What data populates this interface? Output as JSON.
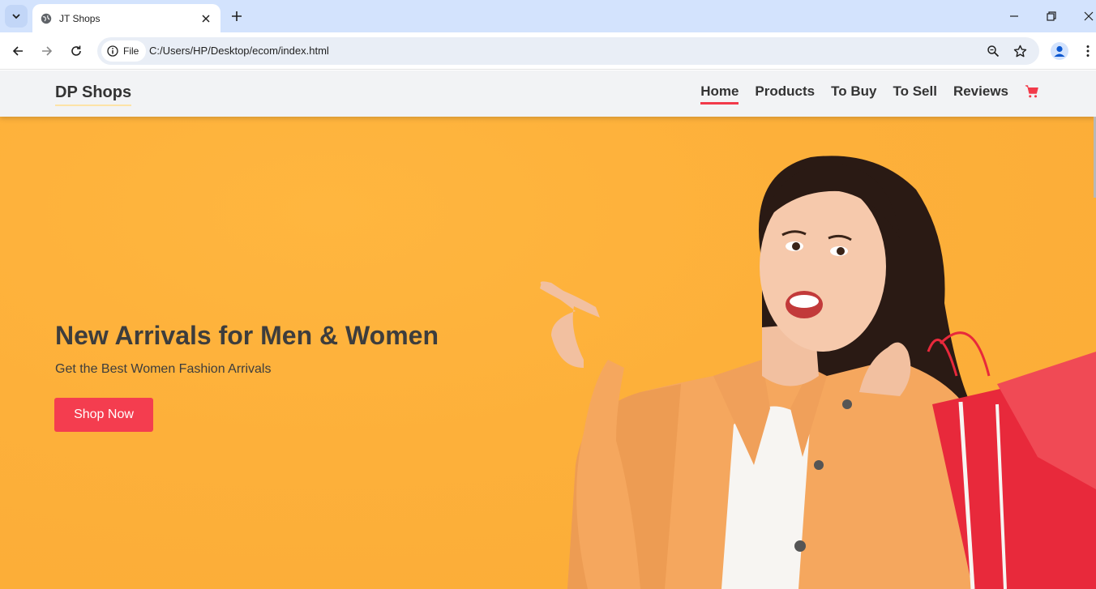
{
  "browser": {
    "tab_title": "JT Shops",
    "url_chip": "File",
    "url": "C:/Users/HP/Desktop/ecom/index.html"
  },
  "site": {
    "logo": "DP Shops",
    "nav": [
      {
        "label": "Home",
        "active": true
      },
      {
        "label": "Products",
        "active": false
      },
      {
        "label": "To Buy",
        "active": false
      },
      {
        "label": "To Sell",
        "active": false
      },
      {
        "label": "Reviews",
        "active": false
      }
    ],
    "cart_icon": "cart-icon"
  },
  "hero": {
    "title": "New Arrivals for Men & Women",
    "subtitle": "Get the Best Women Fashion Arrivals",
    "cta": "Shop Now",
    "image": "woman-with-shopping-bags"
  },
  "colors": {
    "accent": "#f43d4f",
    "hero_bg": "#fdb03a",
    "header_bg": "#f2f3f5",
    "text": "#3d3d3d"
  }
}
